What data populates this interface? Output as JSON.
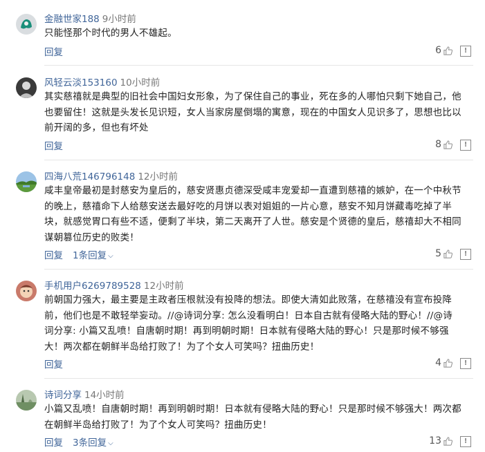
{
  "comments": [
    {
      "avatar": "gray-blob-avatar",
      "username": "金融世家188",
      "time": "9小时前",
      "content": "只能怪那个时代的男人不雄起。",
      "reply_label": "回复",
      "likes": "6",
      "report_symbol": "!"
    },
    {
      "avatar": "dark-portrait-avatar",
      "username": "风轻云淡153160",
      "time": "10小时前",
      "content": "其实慈禧就是典型的旧社会中国妇女形象，为了保住自己的事业，死在多的人哪怕只剩下她自己，他\n也要留住！这就是头发长见识短，女人当家房屋倒塌的寓意，现在的中国女人见识多了，思想也比以\n前开阔的多，但也有坏处",
      "reply_label": "回复",
      "likes": "8",
      "report_symbol": "!"
    },
    {
      "avatar": "landscape-avatar",
      "username": "四海八荒146796148",
      "time": "12小时前",
      "content": "咸丰皇帝最初是封慈安为皇后的，慈安贤惠贞德深受咸丰宠爱却一直遭到慈禧的嫉妒，在一个中秋节\n的晚上，慈禧命下人给慈安送去最好吃的月饼以表对姐姐的一片心意，慈安不知月饼藏毒吃掉了半\n块，就感觉胃口有些不适，便剩了半块，第二天离开了人世。慈安是个贤德的皇后，慈禧却大不相同\n谋朝篡位历史的败类！",
      "reply_label": "回复",
      "sub_replies": "1条回复",
      "likes": "5",
      "report_symbol": "!"
    },
    {
      "avatar": "cartoon-avatar",
      "username": "手机用户6269789528",
      "time": "12小时前",
      "content": "前朝国力强大，最主要是主政者压根就没有投降的想法。即使大清如此败落，在慈禧没有宣布投降\n前，他们也是不敢轻举妄动。//@诗词分享: 怎么没看明白！日本自古就有侵略大陆的野心！//@诗\n词分享: 小篇又乱喷！自唐朝时期！再到明朝时期！日本就有侵略大陆的野心！只是那时候不够强\n大！两次都在朝鲜半岛给打败了！为了个女人可笑吗？扭曲历史！",
      "reply_label": "回复",
      "likes": "4",
      "report_symbol": "!"
    },
    {
      "avatar": "scenery-avatar",
      "username": "诗词分享",
      "time": "14小时前",
      "content": "小篇又乱喷！自唐朝时期！再到明朝时期！日本就有侵略大陆的野心！只是那时候不够强大！两次都\n在朝鲜半岛给打败了！为了个女人可笑吗？扭曲历史！",
      "reply_label": "回复",
      "sub_replies": "3条回复",
      "likes": "13",
      "report_symbol": "!"
    }
  ],
  "colors": {
    "username": "#406599",
    "time": "#777777",
    "text": "#222222",
    "divider": "#e6e6e6"
  }
}
